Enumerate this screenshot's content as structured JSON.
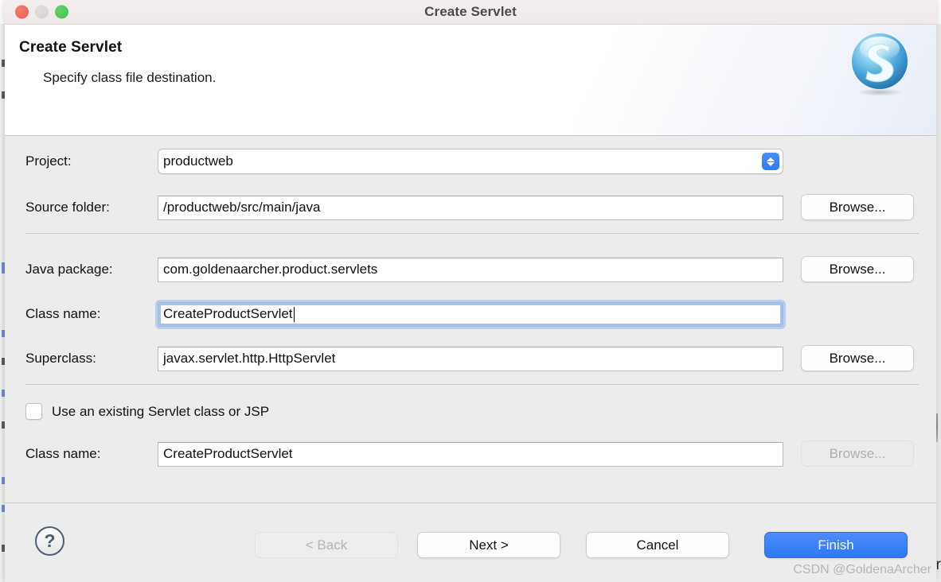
{
  "window": {
    "title": "Create Servlet",
    "traffic_lights": [
      "close-red",
      "minimize-yellow",
      "zoom-green"
    ]
  },
  "header": {
    "title": "Create Servlet",
    "subtitle": "Specify class file destination.",
    "icon": "servlet-s-sphere-icon"
  },
  "form": {
    "project": {
      "label": "Project:",
      "value": "productweb",
      "control": "combo-box"
    },
    "source_folder": {
      "label": "Source folder:",
      "value": "/productweb/src/main/java",
      "browse_label": "Browse..."
    },
    "java_package": {
      "label": "Java package:",
      "value": "com.goldenaarcher.product.servlets",
      "browse_label": "Browse..."
    },
    "class_name": {
      "label": "Class name:",
      "value": "CreateProductServlet",
      "focused": true
    },
    "superclass": {
      "label": "Superclass:",
      "value": "javax.servlet.http.HttpServlet",
      "browse_label": "Browse..."
    },
    "use_existing": {
      "label": "Use an existing Servlet class or JSP",
      "checked": false
    },
    "existing_class_name": {
      "label": "Class name:",
      "value": "CreateProductServlet",
      "browse_label": "Browse...",
      "browse_disabled": true
    }
  },
  "footer": {
    "help_label": "?",
    "back_label": "< Back",
    "next_label": "Next >",
    "cancel_label": "Cancel",
    "finish_label": "Finish",
    "back_disabled": true
  },
  "watermark": "CSDN @GoldenaArcher",
  "colors": {
    "accent": "#2d78f3",
    "dialog_bg": "#ececec",
    "header_bg": "#ffffff",
    "focus_ring": "#a8c0ea",
    "titlebar_bg": "#efe9e9"
  }
}
